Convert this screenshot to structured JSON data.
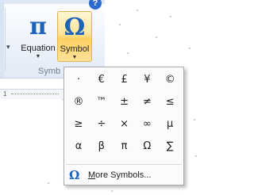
{
  "ribbon": {
    "help_badge": "?",
    "equation": {
      "glyph": "π",
      "label": "Equation",
      "arrow": "▼"
    },
    "symbol": {
      "glyph": "Ω",
      "label": "Symbol",
      "arrow": "▼"
    },
    "group_label": "Symb",
    "left_arrow": "▾"
  },
  "ruler": {
    "number": "1"
  },
  "symbol_menu": {
    "symbols": [
      "·",
      "€",
      "£",
      "¥",
      "©",
      "®",
      "™",
      "±",
      "≠",
      "≤",
      "≥",
      "÷",
      "×",
      "∞",
      "µ",
      "α",
      "β",
      "π",
      "Ω",
      "∑"
    ],
    "more": {
      "icon": "Ω",
      "accel": "M",
      "rest": "ore Symbols..."
    }
  }
}
